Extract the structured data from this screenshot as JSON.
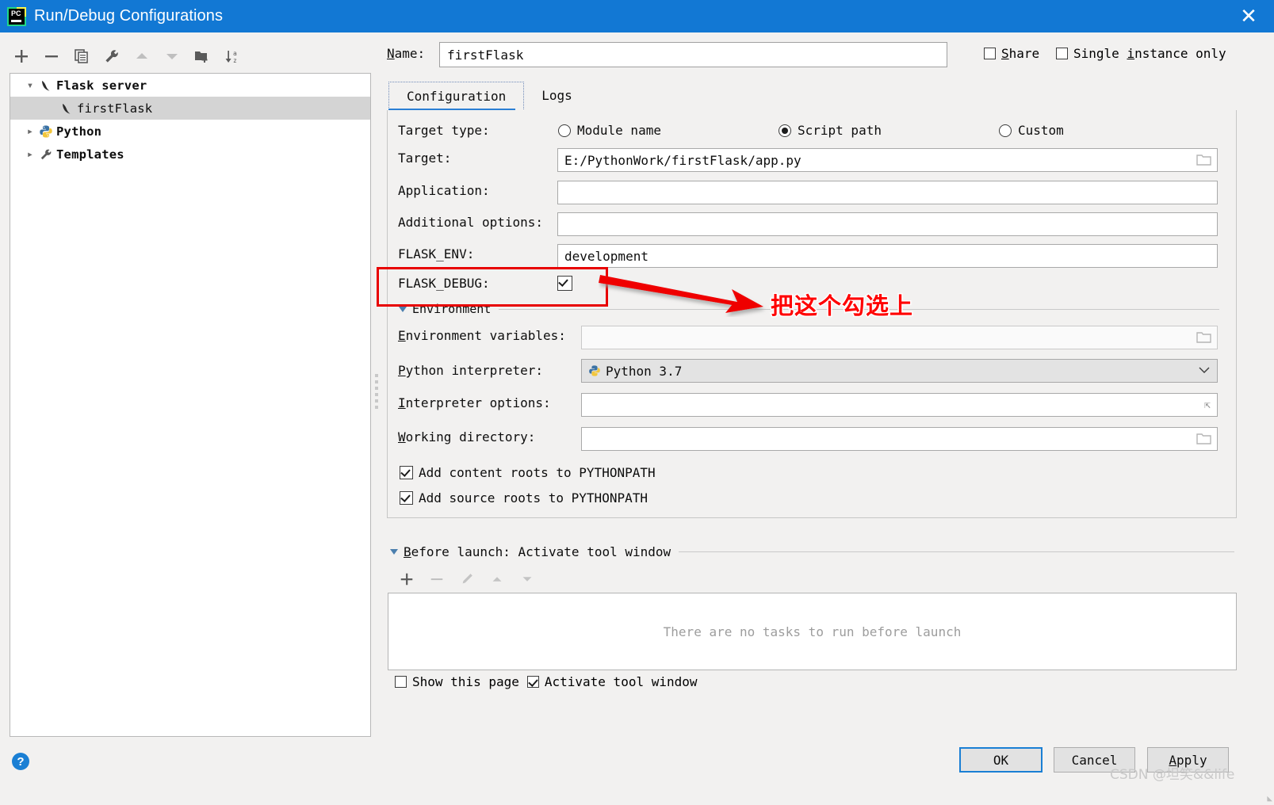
{
  "window": {
    "title": "Run/Debug Configurations",
    "app_icon": "pycharm-icon",
    "close_label": "✕"
  },
  "left_toolbar": {
    "buttons": [
      {
        "name": "add-configuration-button",
        "icon": "plus-icon",
        "enabled": true
      },
      {
        "name": "remove-configuration-button",
        "icon": "minus-icon",
        "enabled": true
      },
      {
        "name": "copy-configuration-button",
        "icon": "copy-icon",
        "enabled": true
      },
      {
        "name": "edit-templates-button",
        "icon": "wrench-icon",
        "enabled": true
      },
      {
        "name": "move-up-button",
        "icon": "arrow-up-icon",
        "enabled": false
      },
      {
        "name": "move-down-button",
        "icon": "arrow-down-icon",
        "enabled": false
      },
      {
        "name": "new-folder-button",
        "icon": "folder-add-icon",
        "enabled": true
      },
      {
        "name": "sort-alphabetically-button",
        "icon": "sort-az-icon",
        "enabled": true
      }
    ]
  },
  "tree": {
    "items": [
      {
        "label": "Flask server",
        "icon": "flask-icon",
        "twisty": "expanded",
        "indent": 0,
        "selected": false,
        "bold": true
      },
      {
        "label": "firstFlask",
        "icon": "flask-icon",
        "twisty": "none",
        "indent": 1,
        "selected": true,
        "bold": false
      },
      {
        "label": "Python",
        "icon": "python-icon",
        "twisty": "collapsed",
        "indent": 0,
        "selected": false,
        "bold": true
      },
      {
        "label": "Templates",
        "icon": "wrench-icon",
        "twisty": "collapsed",
        "indent": 0,
        "selected": false,
        "bold": true
      }
    ]
  },
  "header": {
    "name_label": "Name:",
    "name_label_mnemonic": "N",
    "name_value": "firstFlask",
    "share_label": "Share",
    "share_checked": false,
    "single_instance_label": "Single instance only",
    "single_instance_checked": false
  },
  "tabs": [
    {
      "label": "Configuration",
      "active": true
    },
    {
      "label": "Logs",
      "active": false
    }
  ],
  "configuration": {
    "target_type_label": "Target type:",
    "target_type_options": [
      {
        "label": "Module name",
        "selected": false
      },
      {
        "label": "Script path",
        "selected": true
      },
      {
        "label": "Custom",
        "selected": false
      }
    ],
    "target_label": "Target:",
    "target_value": "E:/PythonWork/firstFlask/app.py",
    "application_label": "Application:",
    "application_value": "",
    "additional_options_label": "Additional options:",
    "additional_options_value": "",
    "flask_env_label": "FLASK_ENV:",
    "flask_env_value": "development",
    "flask_debug_label": "FLASK_DEBUG:",
    "flask_debug_checked": true,
    "environment_section": "Environment",
    "environment_variables_label": "Environment variables:",
    "environment_variables_value": "",
    "python_interpreter_label": "Python interpreter:",
    "python_interpreter_value": "Python 3.7",
    "interpreter_options_label": "Interpreter options:",
    "interpreter_options_value": "",
    "working_directory_label": "Working directory:",
    "working_directory_value": "",
    "add_content_roots_label": "Add content roots to PYTHONPATH",
    "add_content_roots_checked": true,
    "add_source_roots_label": "Add source roots to PYTHONPATH",
    "add_source_roots_checked": true
  },
  "before_launch": {
    "header": "Before launch: Activate tool window",
    "header_mnemonic": "B",
    "toolbar": [
      {
        "name": "add-task-button",
        "icon": "plus-icon",
        "enabled": true
      },
      {
        "name": "remove-task-button",
        "icon": "minus-icon",
        "enabled": false
      },
      {
        "name": "edit-task-button",
        "icon": "pencil-icon",
        "enabled": false
      },
      {
        "name": "task-move-up-button",
        "icon": "arrow-up-icon",
        "enabled": false
      },
      {
        "name": "task-move-down-button",
        "icon": "arrow-down-icon",
        "enabled": false
      }
    ],
    "empty_text": "There are no tasks to run before launch",
    "show_this_page_label": "Show this page",
    "show_this_page_checked": false,
    "activate_tool_window_label": "Activate tool window",
    "activate_tool_window_checked": true
  },
  "footer": {
    "help_label": "?",
    "ok_label": "OK",
    "cancel_label": "Cancel",
    "apply_label": "Apply",
    "apply_mnemonic": "A"
  },
  "annotation": {
    "text": "把这个勾选上",
    "color": "#ff0000",
    "stroke_color": "#ffffff",
    "shape": "rectangle-and-arrow"
  },
  "watermark": {
    "text": "CSDN @坦笑&&life"
  },
  "colors": {
    "titlebar": "#1278d4",
    "accent": "#1a7fd4",
    "background": "#f2f1f0",
    "selection": "#d4d4d4"
  }
}
